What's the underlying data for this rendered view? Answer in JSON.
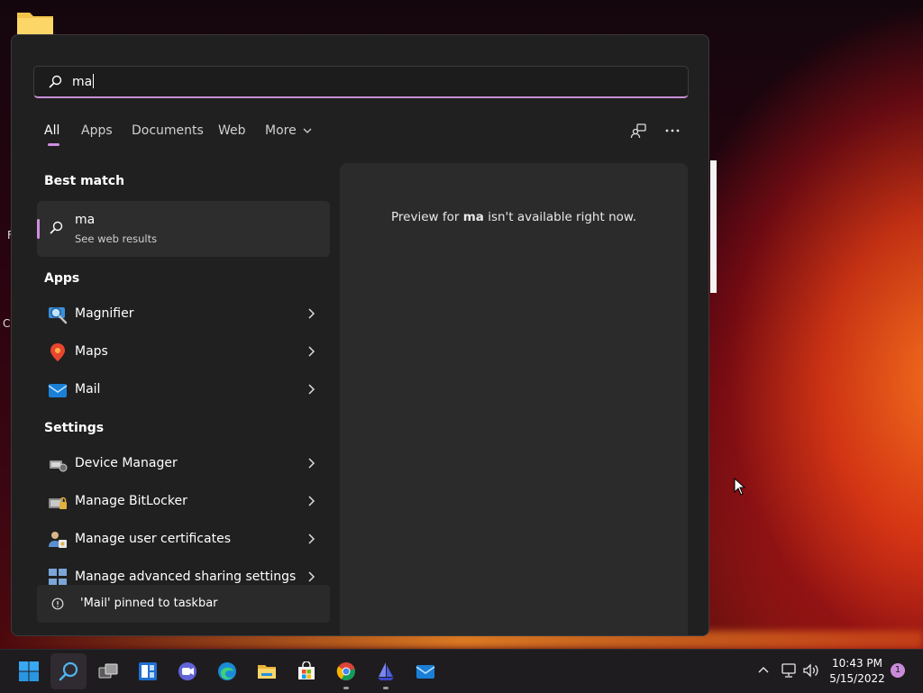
{
  "search": {
    "query": "ma"
  },
  "tabs": [
    {
      "label": "All"
    },
    {
      "label": "Apps"
    },
    {
      "label": "Documents"
    },
    {
      "label": "Web"
    },
    {
      "label": "More"
    }
  ],
  "best_match": {
    "heading": "Best match",
    "title": "ma",
    "subtitle": "See web results"
  },
  "apps": {
    "heading": "Apps",
    "items": [
      {
        "label": "Magnifier",
        "icon": "magnifier-icon"
      },
      {
        "label": "Maps",
        "icon": "maps-icon"
      },
      {
        "label": "Mail",
        "icon": "mail-icon"
      }
    ]
  },
  "settings": {
    "heading": "Settings",
    "items": [
      {
        "label": "Device Manager",
        "icon": "device-manager-icon"
      },
      {
        "label": "Manage BitLocker",
        "icon": "bitlocker-icon"
      },
      {
        "label": "Manage user certificates",
        "icon": "certificates-icon"
      },
      {
        "label": "Manage advanced sharing settings",
        "icon": "sharing-icon"
      }
    ]
  },
  "toast": {
    "text": "'Mail' pinned to taskbar"
  },
  "preview": {
    "prefix": "Preview for ",
    "query": "ma",
    "suffix": " isn't available right now."
  },
  "taskbar": {
    "time": "10:43 PM",
    "date": "5/15/2022",
    "notification_count": "1"
  },
  "colors": {
    "accent": "#d08fe0",
    "panel_bg": "#202020",
    "preview_bg": "#2b2b2b"
  }
}
